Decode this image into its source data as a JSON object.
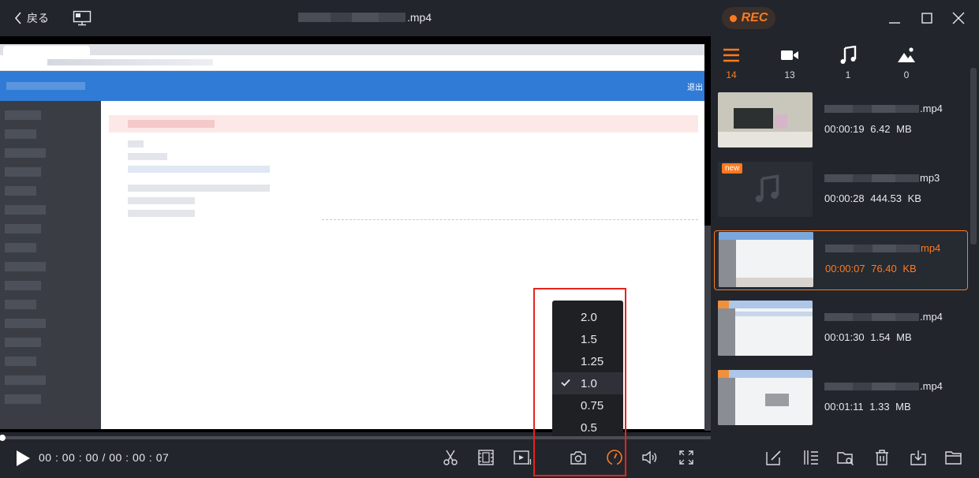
{
  "titlebar": {
    "back_label": "戻る",
    "file_ext": ".mp4",
    "rec_label": "REC"
  },
  "browser": {
    "logout_label": "退出"
  },
  "speed_menu": {
    "options": [
      "2.0",
      "1.5",
      "1.25",
      "1.0",
      "0.75",
      "0.5"
    ],
    "selected": "1.0"
  },
  "player": {
    "time": "00 : 00 : 00 / 00 : 00 : 07",
    "progress": 0
  },
  "categories": [
    {
      "icon": "list-icon",
      "count": "14",
      "active": true
    },
    {
      "icon": "video-icon",
      "count": "13"
    },
    {
      "icon": "music-icon",
      "count": "1"
    },
    {
      "icon": "image-icon",
      "count": "0"
    }
  ],
  "files": [
    {
      "ext": ".mp4",
      "duration": "00:00:19",
      "size": "6.42 MB"
    },
    {
      "ext": "mp3",
      "duration": "00:00:28",
      "size": "444.53 KB",
      "badge": "new"
    },
    {
      "ext": "mp4",
      "duration": "00:00:07",
      "size": "76.40 KB",
      "selected": true
    },
    {
      "ext": ".mp4",
      "duration": "00:01:30",
      "size": "1.54 MB"
    },
    {
      "ext": ".mp4",
      "duration": "00:01:11",
      "size": "1.33 MB"
    }
  ],
  "colors": {
    "accent": "#ff7a1f",
    "highlight_box": "#e8231b",
    "background": "#22252b"
  }
}
